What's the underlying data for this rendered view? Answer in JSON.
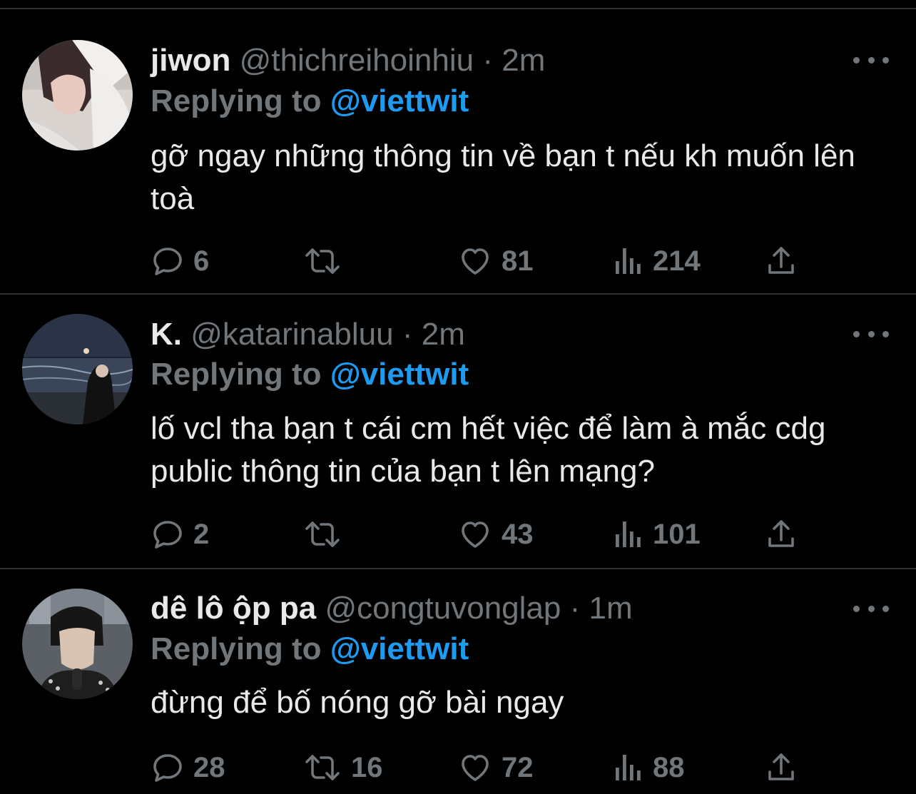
{
  "tweets": [
    {
      "name": "jiwon",
      "handle": "@thichreihoinhiu",
      "dot": "·",
      "time": "2m",
      "replying_label": "Replying to",
      "replying_handle": "@viettwit",
      "text": "gỡ ngay những thông tin về bạn t nếu kh muốn lên toà",
      "replies": "6",
      "retweets": "",
      "likes": "81",
      "views": "214"
    },
    {
      "name": "K.",
      "handle": "@katarinabluu",
      "dot": "·",
      "time": "2m",
      "replying_label": "Replying to",
      "replying_handle": "@viettwit",
      "text": "lố vcl tha bạn t cái cm hết việc để làm à mắc cdg public thông tin của bạn t lên mạng?",
      "replies": "2",
      "retweets": "",
      "likes": "43",
      "views": "101"
    },
    {
      "name": "dê lô ộp pa",
      "handle": "@congtuvonglap",
      "dot": "·",
      "time": "1m",
      "replying_label": "Replying to",
      "replying_handle": "@viettwit",
      "text": "đừng để bố nóng gỡ bài ngay",
      "replies": "28",
      "retweets": "16",
      "likes": "72",
      "views": "88"
    }
  ],
  "colors": {
    "background": "#000000",
    "text": "#e7e9ea",
    "muted": "#71767b",
    "link": "#1d9bf0",
    "divider": "#2f3336"
  },
  "icons": {
    "reply": "reply-icon",
    "retweet": "retweet-icon",
    "like": "heart-icon",
    "views": "views-icon",
    "share": "share-icon",
    "more": "more-icon"
  }
}
